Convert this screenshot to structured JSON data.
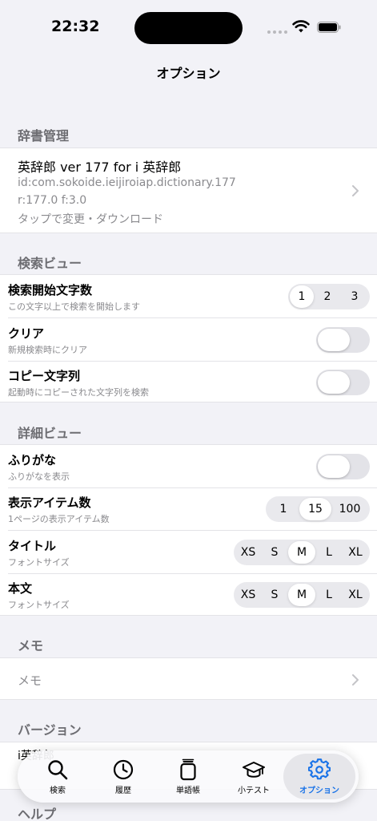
{
  "status": {
    "time": "22:32"
  },
  "nav": {
    "title": "オプション"
  },
  "dictionary_section": {
    "header": "辞書管理",
    "title": "英辞郎 ver 177 for i 英辞郎",
    "id_line": "id:com.sokoide.ieijiroiap.dictionary.177",
    "version_line": "r:177.0 f:3.0",
    "action_line": "タップで変更・ダウンロード"
  },
  "search_view": {
    "header": "検索ビュー",
    "rows": [
      {
        "title": "検索開始文字数",
        "sub": "この文字以上で検索を開始します",
        "options": [
          "1",
          "2",
          "3"
        ],
        "selected": "1"
      },
      {
        "title": "クリア",
        "sub": "新規検索時にクリア",
        "toggle": false
      },
      {
        "title": "コピー文字列",
        "sub": "起動時にコピーされた文字列を検索",
        "toggle": false
      }
    ]
  },
  "detail_view": {
    "header": "詳細ビュー",
    "rows": [
      {
        "title": "ふりがな",
        "sub": "ふりがなを表示",
        "toggle": false
      },
      {
        "title": "表示アイテム数",
        "sub": "1ページの表示アイテム数",
        "options": [
          "1",
          "15",
          "100"
        ],
        "selected": "15"
      },
      {
        "title": "タイトル",
        "sub": "フォントサイズ",
        "options": [
          "XS",
          "S",
          "M",
          "L",
          "XL"
        ],
        "selected": "M"
      },
      {
        "title": "本文",
        "sub": "フォントサイズ",
        "options": [
          "XS",
          "S",
          "M",
          "L",
          "XL"
        ],
        "selected": "M"
      }
    ]
  },
  "memo_section": {
    "header": "メモ",
    "label": "メモ"
  },
  "version_section": {
    "header": "バージョン",
    "partial_text": "i英辞郎"
  },
  "help_section": {
    "header": "ヘルプ"
  },
  "tabs": [
    {
      "label": "検索",
      "icon": "search-icon"
    },
    {
      "label": "履歴",
      "icon": "clock-icon"
    },
    {
      "label": "単語帳",
      "icon": "notebook-icon"
    },
    {
      "label": "小テスト",
      "icon": "graduation-cap-icon"
    },
    {
      "label": "オプション",
      "icon": "gear-icon",
      "active": true
    }
  ],
  "colors": {
    "accent": "#1a73e8",
    "background": "#f2f2f7",
    "secondary_text": "#8a8a8e"
  }
}
